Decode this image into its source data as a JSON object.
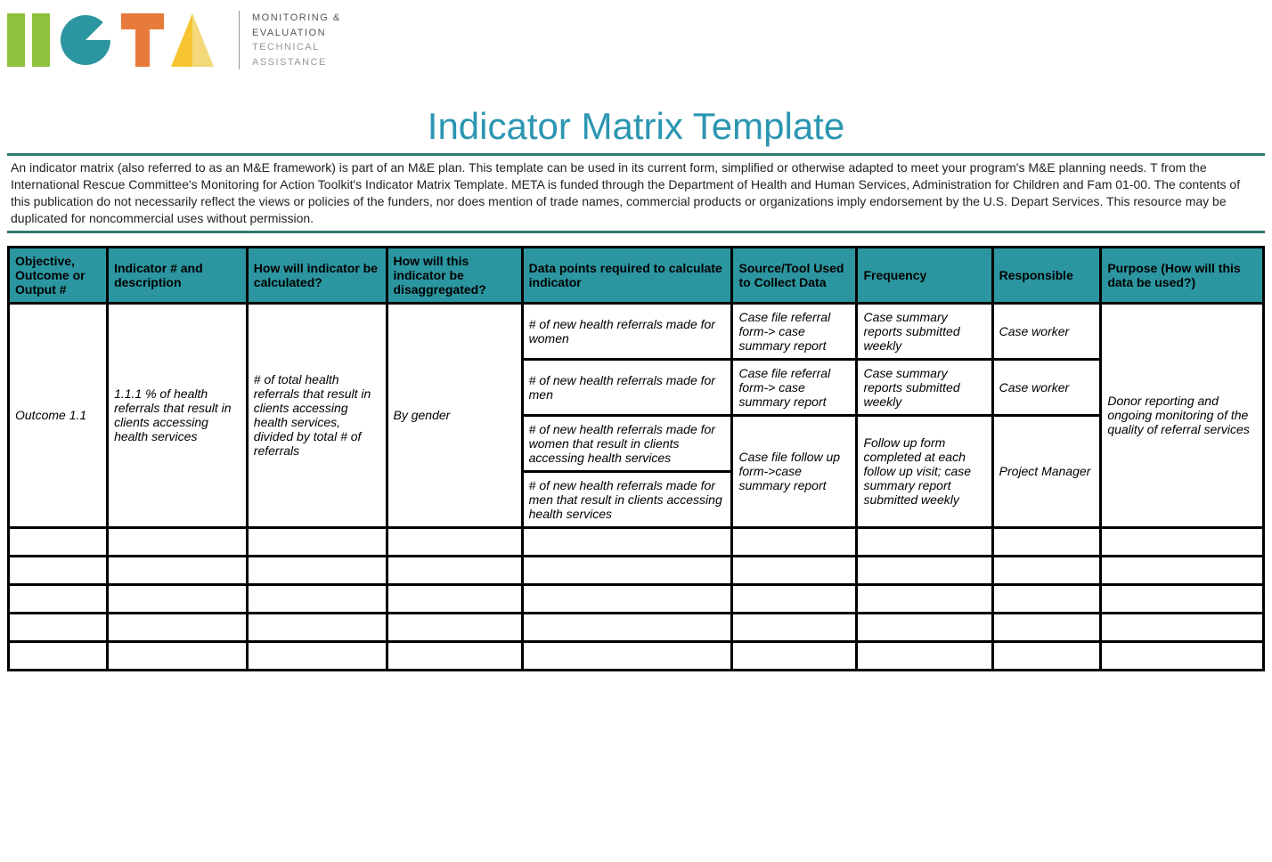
{
  "header": {
    "tagline": {
      "l1": "MONITORING &",
      "l2": "EVALUATION",
      "l3": "TECHNICAL",
      "l4": "ASSISTANCE"
    }
  },
  "title": "Indicator Matrix Template",
  "intro": "An indicator matrix (also referred to as an M&E framework) is part of an M&E plan.  This template can be used in its current form, simplified or otherwise adapted to meet your program's M&E planning needs.   T from the International Rescue Committee's Monitoring for Action Toolkit's Indicator Matrix Template. META is funded through the Department of Health and Human Services, Administration for Children and Fam 01-00. The contents of this publication do not necessarily reflect the views or policies of the funders, nor does mention of trade names, commercial products or organizations imply endorsement by the U.S. Depart Services. This resource may be duplicated for noncommercial uses without permission.",
  "table": {
    "headers": {
      "c1": "Objective, Outcome or Output #",
      "c2": "Indicator # and description",
      "c3": "How will indicator be calculated?",
      "c4": "How will this indicator be disaggregated?",
      "c5": "Data points required to calculate indicator",
      "c6": "Source/Tool Used to Collect Data",
      "c7": "Frequency",
      "c8": "Responsible",
      "c9": "Purpose (How will this data be used?)"
    },
    "row1": {
      "objective": "Outcome 1.1",
      "indicator": "1.1.1 % of health referrals that result in clients accessing health services",
      "calculated": "# of total health referrals that result in clients accessing health services, divided by total # of referrals",
      "disaggregated": "By gender",
      "purpose": "Donor reporting and ongoing monitoring of the quality of referral services",
      "dp1": "# of new health referrals made for women",
      "dp2": "# of new health referrals made for men",
      "dp3": "# of new health referrals made for women that result in clients accessing health services",
      "dp4": "# of new health referrals made for men that result in clients accessing health services",
      "src12": "Case file referral form-> case summary report",
      "src34": "Case file follow up form->case summary report",
      "freq12": "Case summary reports submitted weekly",
      "freq34": "Follow up form completed at each follow up visit; case summary report submitted weekly",
      "resp12": "Case worker",
      "resp34": "Project Manager"
    }
  }
}
